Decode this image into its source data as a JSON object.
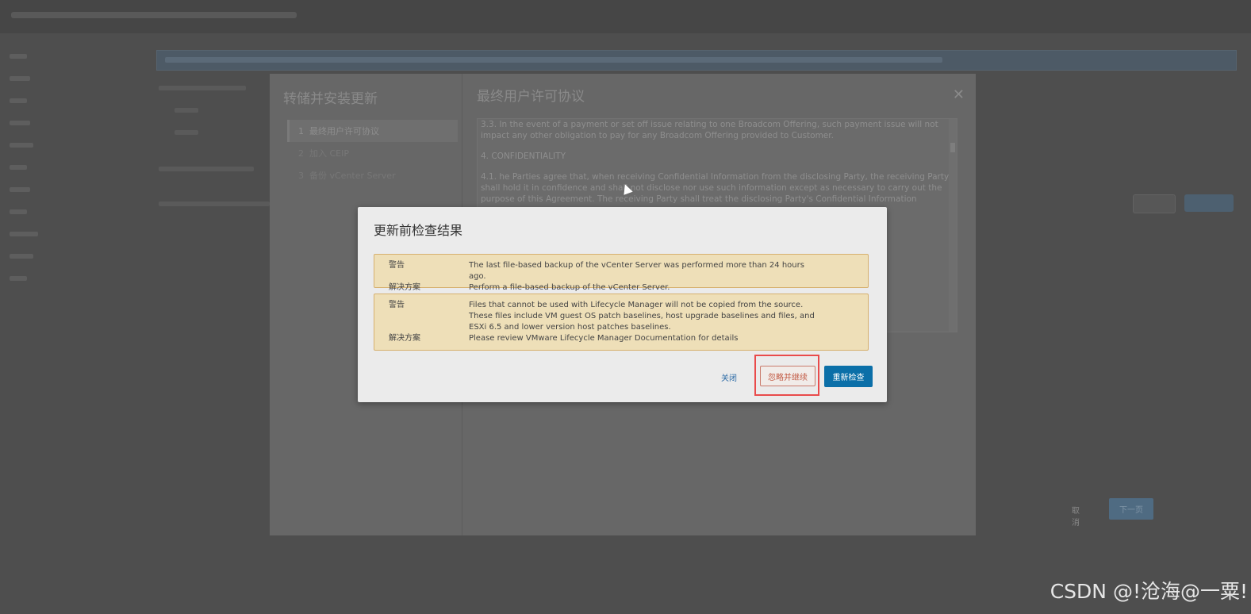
{
  "wizard": {
    "title": "转储并安装更新",
    "steps": [
      {
        "num": "1",
        "label": "最终用户许可协议"
      },
      {
        "num": "2",
        "label": "加入 CEIP"
      },
      {
        "num": "3",
        "label": "备份 vCenter Server"
      }
    ],
    "eula_title": "最终用户许可协议",
    "eula_paragraphs": [
      "3.3. In the event of a payment or set off issue relating to one Broadcom Offering, such payment issue will not impact any other obligation to pay for any Broadcom Offering provided to Customer.",
      "4. CONFIDENTIALITY",
      "4.1. he Parties agree that, when receiving Confidential Information from the disclosing Party, the receiving Party shall hold it in confidence and shall not disclose nor use such information except as necessary to carry out the purpose of this Agreement. The receiving Party shall treat the disclosing Party's Confidential Information"
    ],
    "cancel_label": "取消",
    "next_label": "下一页"
  },
  "precheck": {
    "title": "更新前检查结果",
    "alerts": [
      {
        "warning_label": "警告",
        "warning_text": "The last file-based backup of the vCenter Server was performed more than 24 hours ago.",
        "solution_label": "解决方案",
        "solution_text": "Perform a file-based backup of the vCenter Server."
      },
      {
        "warning_label": "警告",
        "warning_text": "Files that cannot be used with Lifecycle Manager will not be copied from the source. These files include VM guest OS patch baselines, host upgrade baselines and files, and ESXi 6.5 and lower version host patches baselines.",
        "solution_label": "解决方案",
        "solution_text": "Please review VMware Lifecycle Manager Documentation for details"
      }
    ],
    "close_label": "关闭",
    "ignore_label": "忽略并继续",
    "recheck_label": "重新检查"
  },
  "watermark": "CSDN @!沧海@一粟!",
  "colors": {
    "alert_bg": "#eedfb8",
    "alert_border": "#d6b06e",
    "primary": "#0b6fa8",
    "highlight": "#e94b4b"
  }
}
